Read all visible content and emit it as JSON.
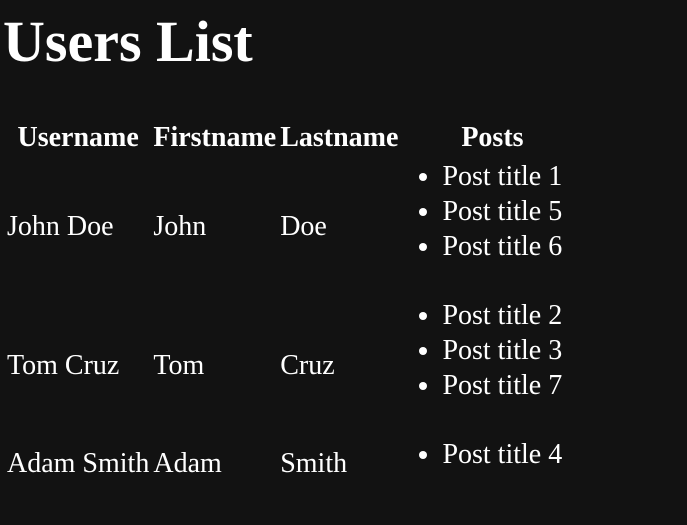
{
  "page": {
    "title": "Users List"
  },
  "table": {
    "headers": [
      "Username",
      "Firstname",
      "Lastname",
      "Posts"
    ],
    "rows": [
      {
        "username": "John Doe",
        "firstname": "John",
        "lastname": "Doe",
        "posts": [
          "Post title 1",
          "Post title 5",
          "Post title 6"
        ]
      },
      {
        "username": "Tom Cruz",
        "firstname": "Tom",
        "lastname": "Cruz",
        "posts": [
          "Post title 2",
          "Post title 3",
          "Post title 7"
        ]
      },
      {
        "username": "Adam Smith",
        "firstname": "Adam",
        "lastname": "Smith",
        "posts": [
          "Post title 4"
        ]
      }
    ]
  },
  "colors": {
    "background": "#121212",
    "text": "#ffffff"
  }
}
